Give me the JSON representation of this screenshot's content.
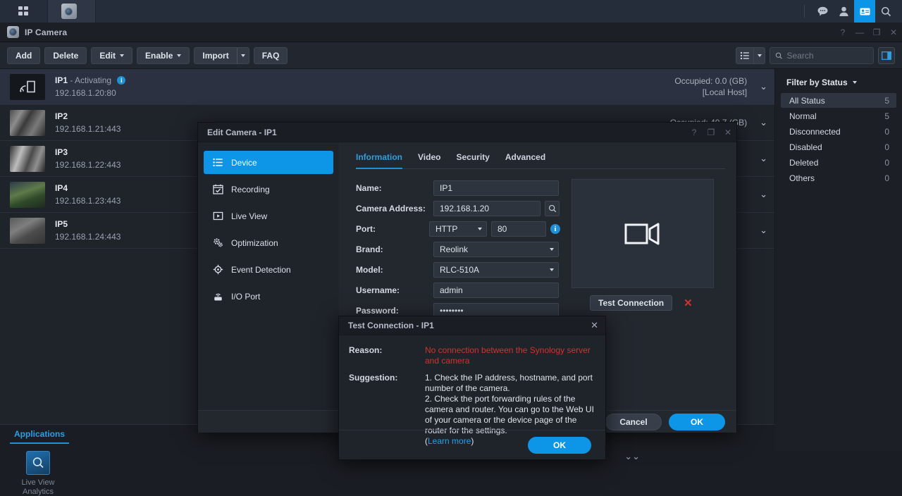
{
  "desktop": {
    "tabs": [
      {
        "name": "apps-grid",
        "icon": "grid-icon"
      },
      {
        "name": "ip-camera-app",
        "icon": "camera-icon"
      }
    ],
    "tray_icons": [
      "chat-icon",
      "user-icon",
      "notifications-icon",
      "search-icon"
    ]
  },
  "app": {
    "title": "IP Camera",
    "window_buttons": [
      "?",
      "—",
      "❐",
      "✕"
    ]
  },
  "toolbar": {
    "add_label": "Add",
    "delete_label": "Delete",
    "edit_label": "Edit",
    "enable_label": "Enable",
    "import_label": "Import",
    "faq_label": "FAQ"
  },
  "search": {
    "placeholder": "Search",
    "value": ""
  },
  "cameras": [
    {
      "name": "IP1",
      "status": "- Activating",
      "has_info": true,
      "address": "192.168.1.20:80",
      "occupied": "Occupied: 0.0 (GB)",
      "host": "[Local Host]",
      "thumb": "placeholder",
      "selected": true
    },
    {
      "name": "IP2",
      "status": "",
      "has_info": false,
      "address": "192.168.1.21:443",
      "occupied": "Occupied: 40.7 (GB)",
      "host": "",
      "thumb": "thumb-a",
      "selected": false
    },
    {
      "name": "IP3",
      "status": "",
      "has_info": false,
      "address": "192.168.1.22:443",
      "occupied": "",
      "host": "",
      "thumb": "thumb-b",
      "selected": false
    },
    {
      "name": "IP4",
      "status": "",
      "has_info": false,
      "address": "192.168.1.23:443",
      "occupied": "",
      "host": "",
      "thumb": "thumb-c",
      "selected": false
    },
    {
      "name": "IP5",
      "status": "",
      "has_info": false,
      "address": "192.168.1.24:443",
      "occupied": "",
      "host": "",
      "thumb": "thumb-d",
      "selected": false
    }
  ],
  "filter": {
    "title": "Filter by Status",
    "items": [
      {
        "label": "All Status",
        "count": "5",
        "active": true
      },
      {
        "label": "Normal",
        "count": "5",
        "active": false
      },
      {
        "label": "Disconnected",
        "count": "0",
        "active": false
      },
      {
        "label": "Disabled",
        "count": "0",
        "active": false
      },
      {
        "label": "Deleted",
        "count": "0",
        "active": false
      },
      {
        "label": "Others",
        "count": "0",
        "active": false
      }
    ]
  },
  "applications": {
    "tab_label": "Applications",
    "items": [
      {
        "label_line1": "Live View",
        "label_line2": "Analytics",
        "icon": "live-view-analytics-icon"
      }
    ]
  },
  "dialog": {
    "title": "Edit Camera - IP1",
    "window_buttons": [
      "?",
      "❐",
      "✕"
    ],
    "nav": [
      {
        "label": "Device",
        "icon": "list-icon",
        "active": true
      },
      {
        "label": "Recording",
        "icon": "calendar-check-icon",
        "active": false
      },
      {
        "label": "Live View",
        "icon": "play-box-icon",
        "active": false
      },
      {
        "label": "Optimization",
        "icon": "gears-icon",
        "active": false
      },
      {
        "label": "Event Detection",
        "icon": "crosshair-icon",
        "active": false
      },
      {
        "label": "I/O Port",
        "icon": "io-port-icon",
        "active": false
      }
    ],
    "tabs": [
      {
        "label": "Information",
        "active": true
      },
      {
        "label": "Video",
        "active": false
      },
      {
        "label": "Security",
        "active": false
      },
      {
        "label": "Advanced",
        "active": false
      }
    ],
    "fields": {
      "name_label": "Name:",
      "name_value": "IP1",
      "address_label": "Camera Address:",
      "address_value": "192.168.1.20",
      "port_label": "Port:",
      "port_protocol": "HTTP",
      "port_value": "80",
      "brand_label": "Brand:",
      "brand_value": "Reolink",
      "model_label": "Model:",
      "model_value": "RLC-510A",
      "username_label": "Username:",
      "username_value": "admin",
      "password_label": "Password:",
      "password_value": "••••••••"
    },
    "test_button_label": "Test Connection",
    "test_result_icon": "x-mark-failed",
    "cancel_label": "Cancel",
    "ok_label": "OK"
  },
  "test_dialog": {
    "title": "Test Connection - IP1",
    "close_icon": "close-icon",
    "reason_label": "Reason:",
    "reason_text": "No connection between the Synology server and camera",
    "suggestion_label": "Suggestion:",
    "suggestion_text": "1. Check the IP address, hostname, and port number of the camera.\n2. Check the port forwarding rules of the camera and router. You can go to the Web UI of your camera or the device page of the router for the settings.",
    "learn_more_prefix": "(",
    "learn_more_label": "Learn more",
    "learn_more_suffix": ")",
    "ok_label": "OK"
  },
  "colors": {
    "accent": "#0d95e8",
    "link": "#2f9ee0",
    "error": "#d0342c",
    "window_bg": "#1a1d23",
    "panel_bg": "#1f232a",
    "selected_row": "#2b3140"
  }
}
